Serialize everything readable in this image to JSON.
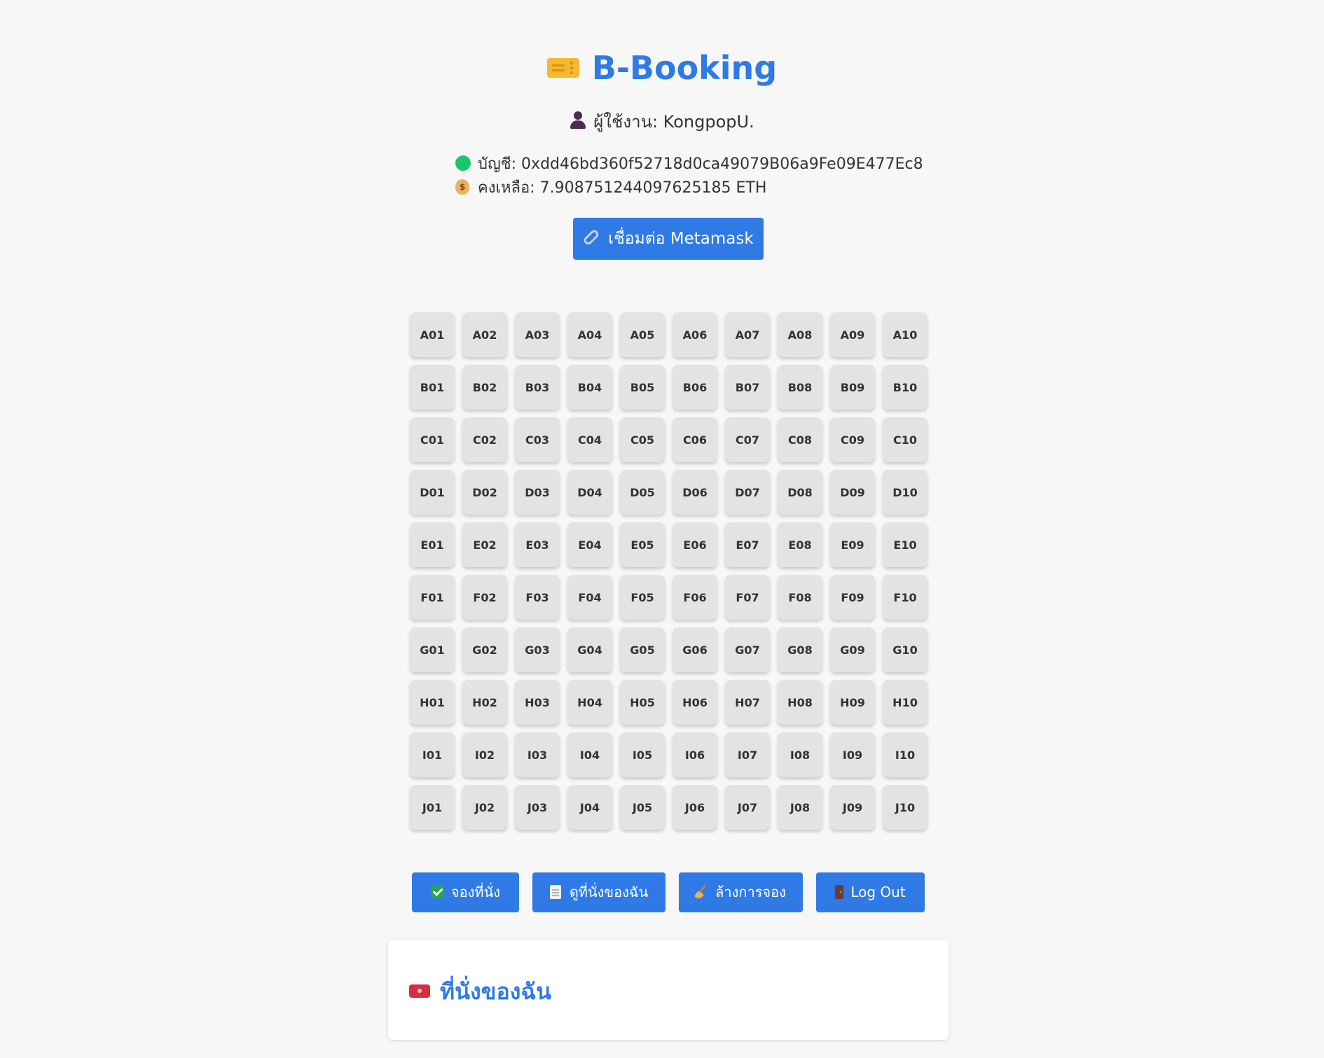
{
  "header": {
    "title": "B-Booking",
    "icon": "ticket-icon",
    "user_label": "ผู้ใช้งาน: KongpopU."
  },
  "account": {
    "account_label": "บัญชี: 0xdd46bd360f52718d0ca49079B06a9Fe09E477Ec8",
    "balance_label": "คงเหลือ: 7.908751244097625185 ETH",
    "status_color": "#19c76a"
  },
  "actions": {
    "connect_label": "เชื่อมต่อ Metamask",
    "book_label": "จองที่นั่ง",
    "my_seats_label": "ดูที่นั่งของฉัน",
    "clear_label": "ล้างการจอง",
    "logout_label": "Log Out"
  },
  "seats": [
    "A01",
    "A02",
    "A03",
    "A04",
    "A05",
    "A06",
    "A07",
    "A08",
    "A09",
    "A10",
    "B01",
    "B02",
    "B03",
    "B04",
    "B05",
    "B06",
    "B07",
    "B08",
    "B09",
    "B10",
    "C01",
    "C02",
    "C03",
    "C04",
    "C05",
    "C06",
    "C07",
    "C08",
    "C09",
    "C10",
    "D01",
    "D02",
    "D03",
    "D04",
    "D05",
    "D06",
    "D07",
    "D08",
    "D09",
    "D10",
    "E01",
    "E02",
    "E03",
    "E04",
    "E05",
    "E06",
    "E07",
    "E08",
    "E09",
    "E10",
    "F01",
    "F02",
    "F03",
    "F04",
    "F05",
    "F06",
    "F07",
    "F08",
    "F09",
    "F10",
    "G01",
    "G02",
    "G03",
    "G04",
    "G05",
    "G06",
    "G07",
    "G08",
    "G09",
    "G10",
    "H01",
    "H02",
    "H03",
    "H04",
    "H05",
    "H06",
    "H07",
    "H08",
    "H09",
    "H10",
    "I01",
    "I02",
    "I03",
    "I04",
    "I05",
    "I06",
    "I07",
    "I08",
    "I09",
    "I10",
    "J01",
    "J02",
    "J03",
    "J04",
    "J05",
    "J06",
    "J07",
    "J08",
    "J09",
    "J10"
  ],
  "my_seats": {
    "title": "ที่นั่งของฉัน"
  },
  "theme": {
    "accent": "#2f7ae5",
    "seat_background": "#e3e3e3",
    "page_background": "#f7f7f7"
  }
}
